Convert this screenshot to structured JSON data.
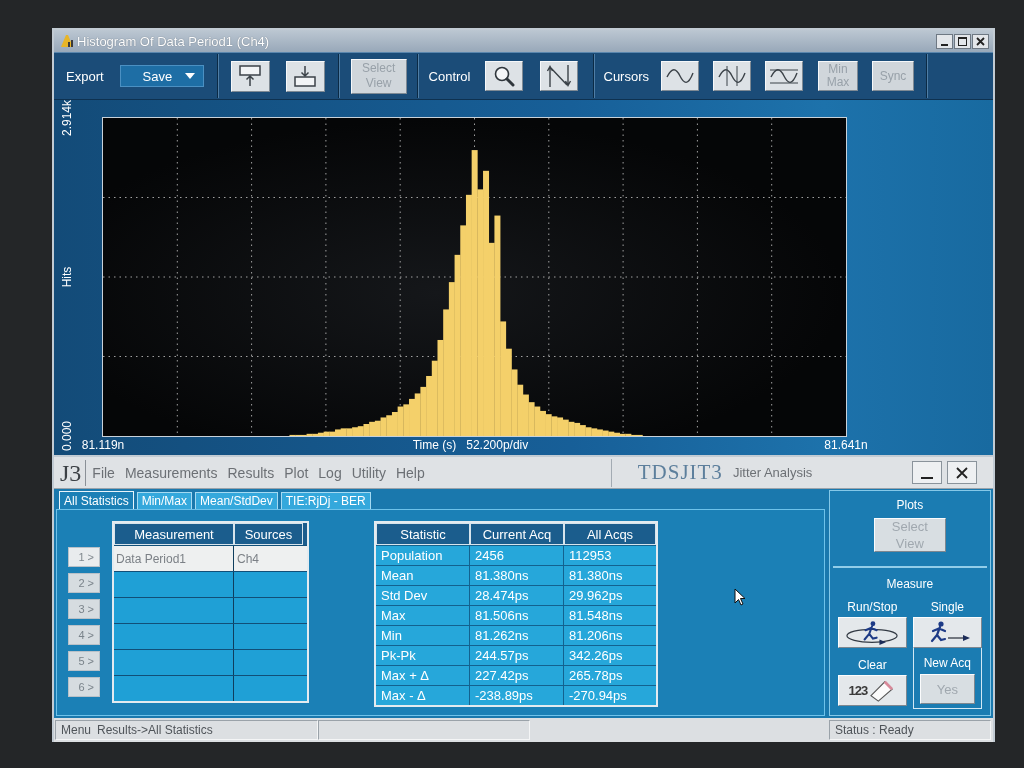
{
  "histogram_window": {
    "title": "Histogram Of Data Period1 (Ch4)",
    "toolbar": {
      "export_label": "Export",
      "save_dropdown": "Save",
      "select_view": {
        "text": "Select View",
        "disabled": true
      },
      "control_label": "Control",
      "cursors_label": "Cursors",
      "min_max": {
        "text": "Min Max",
        "disabled": true
      },
      "sync": {
        "text": "Sync",
        "disabled": true
      }
    },
    "chart": {
      "scale": "52.200p/div",
      "chart_data": {
        "type": "bar",
        "xlabel": "Time (s)",
        "ylabel": "Hits",
        "xlim": [
          81.119,
          81.641
        ],
        "ylim": [
          0,
          2914
        ],
        "xticks": [
          {
            "value": 81.119,
            "label": "81.119n"
          },
          {
            "value": 81.641,
            "label": "81.641n"
          }
        ],
        "yticks": [
          {
            "value": 0,
            "label": "0.000"
          },
          {
            "value": 2914,
            "label": "2.914k"
          }
        ],
        "x": [
          81.252,
          81.256,
          81.26,
          81.264,
          81.268,
          81.272,
          81.276,
          81.28,
          81.284,
          81.288,
          81.292,
          81.296,
          81.3,
          81.304,
          81.308,
          81.312,
          81.316,
          81.32,
          81.324,
          81.328,
          81.332,
          81.336,
          81.34,
          81.344,
          81.348,
          81.352,
          81.356,
          81.36,
          81.364,
          81.368,
          81.372,
          81.376,
          81.38,
          81.384,
          81.388,
          81.392,
          81.396,
          81.4,
          81.404,
          81.408,
          81.412,
          81.416,
          81.42,
          81.424,
          81.428,
          81.432,
          81.436,
          81.44,
          81.444,
          81.448,
          81.452,
          81.456,
          81.46,
          81.464,
          81.468,
          81.472,
          81.476,
          81.48,
          81.484,
          81.488,
          81.492,
          81.496
        ],
        "values": [
          10,
          10,
          10,
          20,
          20,
          30,
          40,
          40,
          60,
          70,
          70,
          80,
          90,
          110,
          130,
          140,
          170,
          190,
          220,
          270,
          290,
          340,
          390,
          450,
          550,
          690,
          880,
          1160,
          1410,
          1660,
          1930,
          2210,
          2620,
          2260,
          2430,
          1770,
          2020,
          1050,
          800,
          610,
          470,
          380,
          310,
          270,
          230,
          200,
          180,
          170,
          150,
          130,
          120,
          100,
          80,
          70,
          60,
          50,
          40,
          30,
          20,
          20,
          10,
          10
        ]
      }
    }
  },
  "jitter_app": {
    "logo": "J3",
    "menu": [
      "File",
      "Measurements",
      "Results",
      "Plot",
      "Log",
      "Utility",
      "Help"
    ],
    "product": "TDSJIT3",
    "subtitle": "Jitter Analysis",
    "tabs": [
      {
        "label": "All Statistics",
        "selected": true
      },
      {
        "label": "Min/Max",
        "selected": false
      },
      {
        "label": "Mean/StdDev",
        "selected": false
      },
      {
        "label": "TIE:RjDj - BER",
        "selected": false
      }
    ],
    "measurement_table": {
      "columns": [
        "Measurement",
        "Sources"
      ]
    },
    "slots": [
      {
        "label": "1 >",
        "disabled": false,
        "selected": true,
        "measurement": "Data Period1",
        "source": "Ch4"
      },
      {
        "label": "2 >",
        "disabled": true,
        "selected": false
      },
      {
        "label": "3 >",
        "disabled": true,
        "selected": false
      },
      {
        "label": "4 >",
        "disabled": true,
        "selected": false
      },
      {
        "label": "5 >",
        "disabled": true,
        "selected": false
      },
      {
        "label": "6 >",
        "disabled": true,
        "selected": false
      }
    ],
    "statistics_table": {
      "columns": [
        "Statistic",
        "Current Acq",
        "All Acqs"
      ],
      "rows": [
        [
          "Population",
          "2456",
          "112953"
        ],
        [
          "Mean",
          "81.380ns",
          "81.380ns"
        ],
        [
          "Std Dev",
          "28.474ps",
          "29.962ps"
        ],
        [
          "Max",
          "81.506ns",
          "81.548ns"
        ],
        [
          "Min",
          "81.262ns",
          "81.206ns"
        ],
        [
          "Pk-Pk",
          "244.57ps",
          "342.26ps"
        ],
        [
          "Max + Δ",
          "227.42ps",
          "265.78ps"
        ],
        [
          "Max - Δ",
          "-238.89ps",
          "-270.94ps"
        ]
      ]
    },
    "plots_panel": {
      "title": "Plots",
      "select_view": {
        "text": "Select View",
        "disabled": true
      }
    },
    "measure_panel": {
      "title": "Measure",
      "run_stop_label": "Run/Stop",
      "single_label": "Single",
      "clear_label": "Clear",
      "clear_icon_text": "123",
      "new_acq_label": "New Acq",
      "new_acq_button": {
        "text": "Yes",
        "disabled": true
      }
    },
    "status_bar": {
      "menu_label": "Menu",
      "menu_path": "Results->All Statistics",
      "status": "Status : Ready"
    }
  }
}
